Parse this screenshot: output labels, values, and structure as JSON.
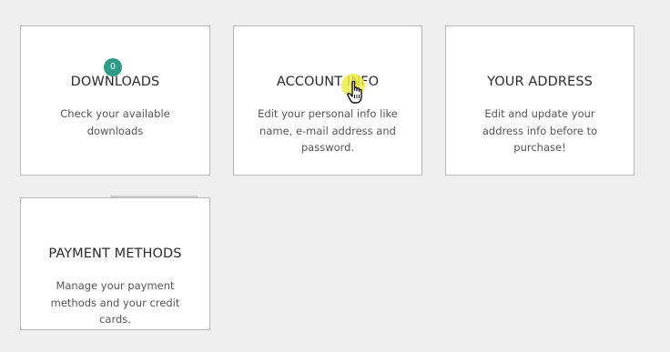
{
  "cards": {
    "downloads": {
      "title": "DOWNLOADS",
      "description": "Check your available downloads",
      "badge_count": "0"
    },
    "account_info": {
      "title": "ACCOUNT INFO",
      "description": "Edit your personal info like name, e-mail address and password."
    },
    "your_address": {
      "title": "YOUR ADDRESS",
      "description": "Edit and update your address info before to purchase!"
    },
    "payment_methods": {
      "title": "PAYMENT METHODS",
      "description": "Manage your payment methods and your credit cards."
    }
  },
  "badge_color": "#2e9b86",
  "cursor": {
    "icon": "hand-pointer-icon",
    "highlight_color": "#f0eb46"
  }
}
